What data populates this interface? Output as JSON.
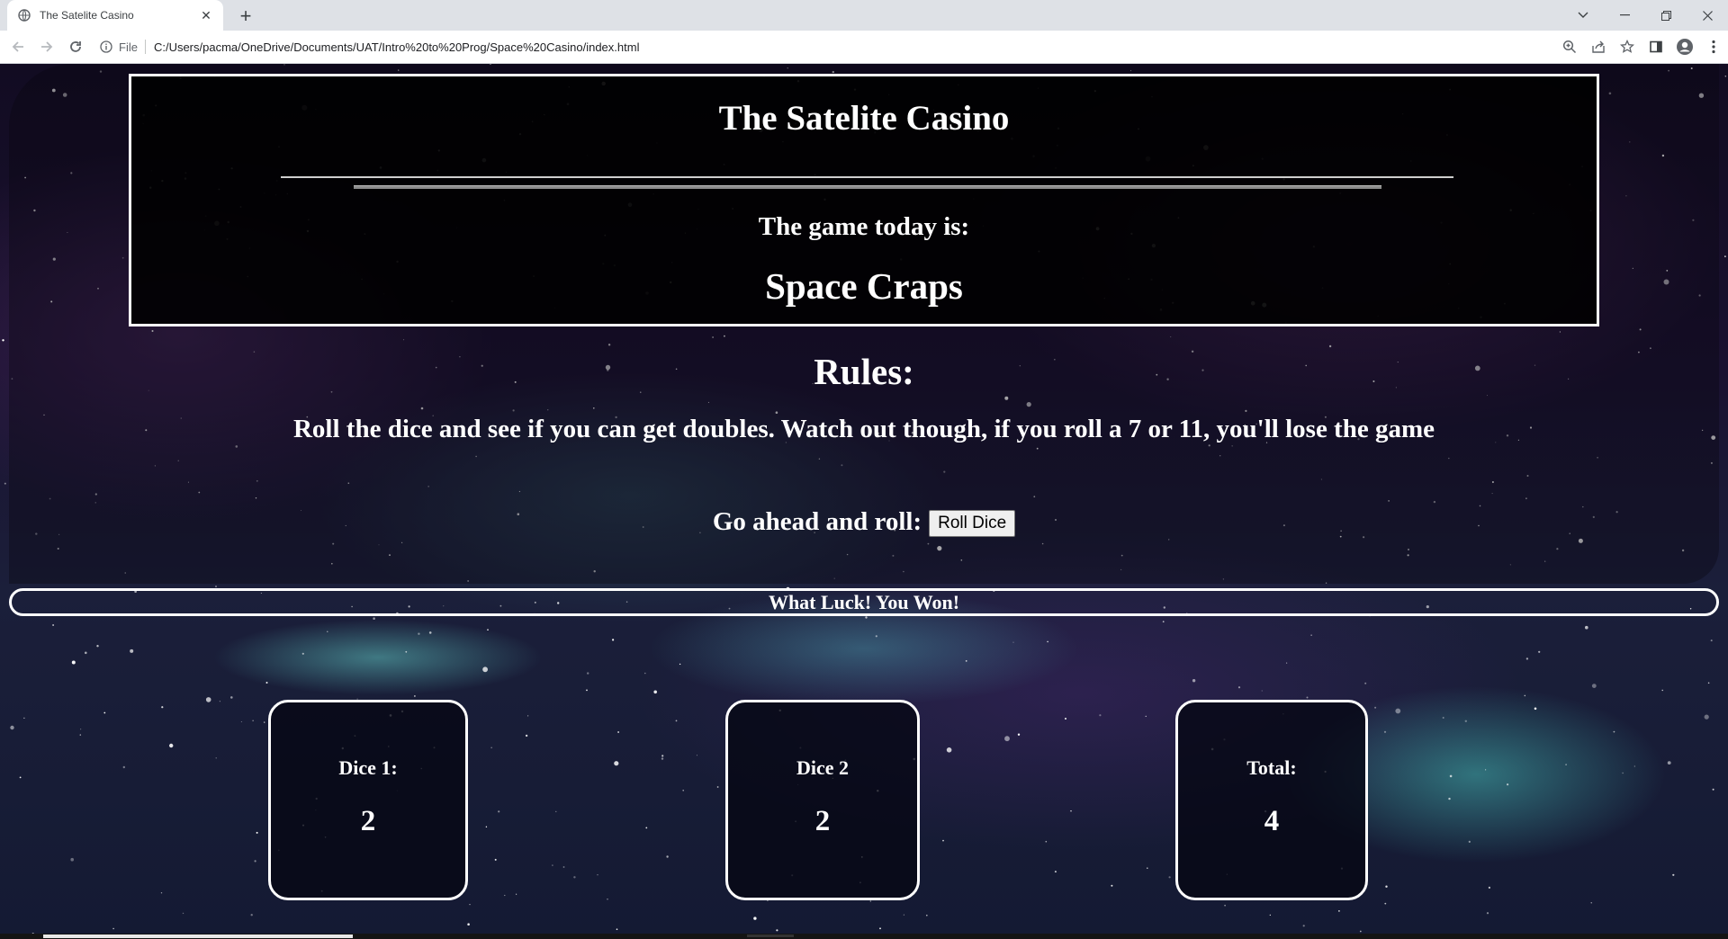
{
  "browser": {
    "tab_title": "The Satelite Casino",
    "url_scheme": "File",
    "url": "C:/Users/pacma/OneDrive/Documents/UAT/Intro%20to%20Prog/Space%20Casino/index.html",
    "new_tab_label": "+",
    "close_tab_label": "✕"
  },
  "header": {
    "title": "The Satelite Casino",
    "game_intro": "The game today is:",
    "game_name": "Space Craps"
  },
  "rules": {
    "heading": "Rules:",
    "text": "Roll the dice and see if you can get doubles. Watch out though, if you roll a 7 or 11, you'll lose the game"
  },
  "roll": {
    "prompt": "Go ahead and roll:",
    "button_label": "Roll Dice"
  },
  "result": {
    "message": "What Luck! You Won!"
  },
  "dice": [
    {
      "label": "Dice 1:",
      "value": "2"
    },
    {
      "label": "Dice 2",
      "value": "2"
    },
    {
      "label": "Total:",
      "value": "4"
    }
  ],
  "colors": {
    "text": "#ffffff",
    "panel": "#000000",
    "border": "#ffffff",
    "space_teal": "#6ee6dc",
    "space_purple": "#5a2c78"
  }
}
